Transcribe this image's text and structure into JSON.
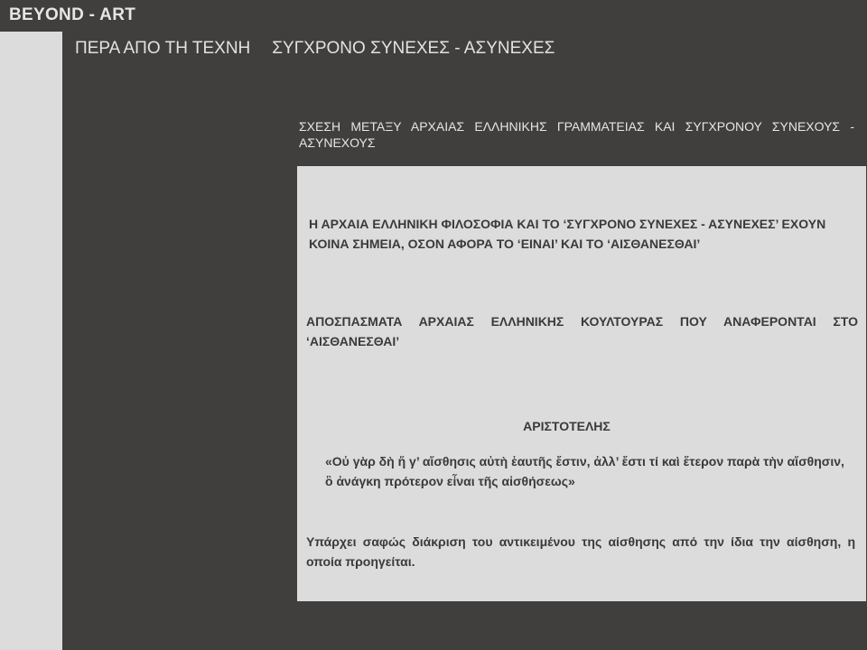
{
  "site": {
    "title": "BEYOND - ART"
  },
  "header": {
    "title_left": "ΠΕΡΑ ΑΠΟ ΤΗ ΤΕΧΝΗ",
    "title_right": "ΣΥΓΧΡΟΝΟ ΣΥΝΕΧΕΣ - ΑΣΥΝΕΧΕΣ"
  },
  "main": {
    "subtitle": "ΣΧΕΣΗ ΜΕΤΑΞΥ ΑΡΧΑΙΑΣ ΕΛΛΗΝΙΚΗΣ ΓΡΑΜΜΑΤΕΙΑΣ ΚΑΙ ΣΥΓΧΡΟΝΟΥ ΣΥΝΕΧΟΥΣ - ΑΣΥΝΕΧΟΥΣ",
    "paragraph1": "Η ΑΡΧΑΙΑ ΕΛΛΗΝΙΚΗ ΦΙΛΟΣΟΦΙΑ ΚΑΙ ΤΟ ‘ΣΥΓΧΡΟΝΟ ΣΥΝΕΧΕΣ - ΑΣΥΝΕΧΕΣ’ ΕΧΟΥΝ ΚΟΙΝΑ ΣΗΜΕΙΑ, ΟΣΟΝ ΑΦΟΡΑ ΤΟ ‘ΕΙΝΑΙ’ ΚΑΙ ΤΟ ‘ΑΙΣΘΑΝΕΣΘΑΙ’",
    "paragraph2": "ΑΠΟΣΠΑΣΜΑΤΑ ΑΡΧΑΙΑΣ ΕΛΛΗΝΙΚΗΣ ΚΟΥΛΤΟΥΡΑΣ ΠΟΥ ΑΝΑΦΕΡΟΝΤΑΙ ΣΤΟ ‘ΑΙΣΘΑΝΕΣΘΑΙ’",
    "author": "ΑΡΙΣΤΟΤΕΛΗΣ",
    "quote": "«Οὐ γὰρ δὴ ἥ γ’ αἴσθησις αὐτὴ ἑαυτῆς ἔστιν, ἀλλ’ ἔστι τί καὶ ἕτερον παρὰ τὴν αἴσθησιν, ὃ ἀνάγκη πρότερον εἶναι τῆς αἰσθήσεως»",
    "paragraph3": "Υπάρχει σαφώς διάκριση του αντικειμένου της αίσθησης από την ίδια την αίσθηση, η οποία προηγείται."
  },
  "colors": {
    "background": "#403f3e",
    "panel": "#dcdcdc",
    "header_text": "#e6e6e6",
    "body_text": "#3a3a3a"
  }
}
